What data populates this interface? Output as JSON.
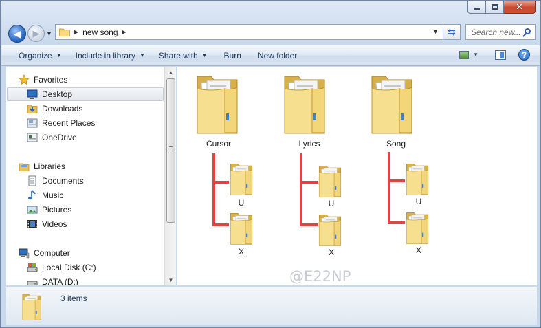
{
  "window": {
    "close_glyph": "✕",
    "caption_icons": [
      "minimize-icon",
      "maximize-icon",
      "close-icon"
    ]
  },
  "address_bar": {
    "path": [
      "new song"
    ],
    "refresh_icon": "refresh-icon",
    "search_placeholder": "Search new..."
  },
  "toolbar": {
    "organize": "Organize",
    "include_in_library": "Include in library",
    "share_with": "Share with",
    "burn": "Burn",
    "new_folder": "New folder"
  },
  "nav": {
    "favorites": "Favorites",
    "desktop": "Desktop",
    "downloads": "Downloads",
    "recent_places": "Recent Places",
    "onedrive": "OneDrive",
    "libraries": "Libraries",
    "documents": "Documents",
    "music": "Music",
    "pictures": "Pictures",
    "videos": "Videos",
    "computer": "Computer",
    "local_disk": "Local Disk (C:)",
    "data_disk": "DATA (D:)"
  },
  "content": {
    "folders": [
      {
        "name": "Cursor",
        "children": [
          "U",
          "X"
        ]
      },
      {
        "name": "Lyrics",
        "children": [
          "U",
          "X"
        ]
      },
      {
        "name": "Song",
        "children": [
          "U",
          "X"
        ]
      }
    ],
    "watermark": "@E22NP",
    "connector_color": "#e04545"
  },
  "status": {
    "item_count": "3 items"
  }
}
